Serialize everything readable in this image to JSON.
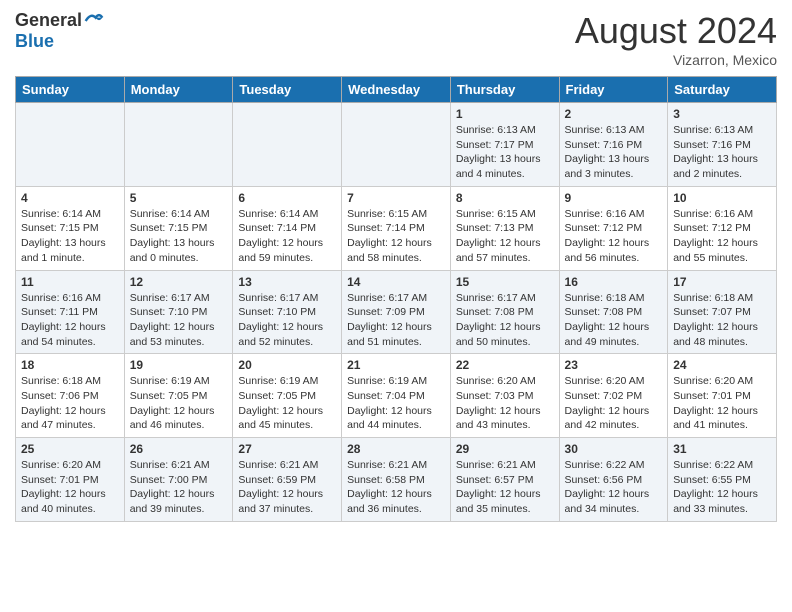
{
  "header": {
    "logo_general": "General",
    "logo_blue": "Blue",
    "month_year": "August 2024",
    "location": "Vizarron, Mexico"
  },
  "days_of_week": [
    "Sunday",
    "Monday",
    "Tuesday",
    "Wednesday",
    "Thursday",
    "Friday",
    "Saturday"
  ],
  "weeks": [
    [
      {
        "day": "",
        "sunrise": "",
        "sunset": "",
        "daylight": "",
        "empty": true
      },
      {
        "day": "",
        "sunrise": "",
        "sunset": "",
        "daylight": "",
        "empty": true
      },
      {
        "day": "",
        "sunrise": "",
        "sunset": "",
        "daylight": "",
        "empty": true
      },
      {
        "day": "",
        "sunrise": "",
        "sunset": "",
        "daylight": "",
        "empty": true
      },
      {
        "day": "1",
        "sunrise": "Sunrise: 6:13 AM",
        "sunset": "Sunset: 7:17 PM",
        "daylight": "Daylight: 13 hours and 4 minutes."
      },
      {
        "day": "2",
        "sunrise": "Sunrise: 6:13 AM",
        "sunset": "Sunset: 7:16 PM",
        "daylight": "Daylight: 13 hours and 3 minutes."
      },
      {
        "day": "3",
        "sunrise": "Sunrise: 6:13 AM",
        "sunset": "Sunset: 7:16 PM",
        "daylight": "Daylight: 13 hours and 2 minutes."
      }
    ],
    [
      {
        "day": "4",
        "sunrise": "Sunrise: 6:14 AM",
        "sunset": "Sunset: 7:15 PM",
        "daylight": "Daylight: 13 hours and 1 minute."
      },
      {
        "day": "5",
        "sunrise": "Sunrise: 6:14 AM",
        "sunset": "Sunset: 7:15 PM",
        "daylight": "Daylight: 13 hours and 0 minutes."
      },
      {
        "day": "6",
        "sunrise": "Sunrise: 6:14 AM",
        "sunset": "Sunset: 7:14 PM",
        "daylight": "Daylight: 12 hours and 59 minutes."
      },
      {
        "day": "7",
        "sunrise": "Sunrise: 6:15 AM",
        "sunset": "Sunset: 7:14 PM",
        "daylight": "Daylight: 12 hours and 58 minutes."
      },
      {
        "day": "8",
        "sunrise": "Sunrise: 6:15 AM",
        "sunset": "Sunset: 7:13 PM",
        "daylight": "Daylight: 12 hours and 57 minutes."
      },
      {
        "day": "9",
        "sunrise": "Sunrise: 6:16 AM",
        "sunset": "Sunset: 7:12 PM",
        "daylight": "Daylight: 12 hours and 56 minutes."
      },
      {
        "day": "10",
        "sunrise": "Sunrise: 6:16 AM",
        "sunset": "Sunset: 7:12 PM",
        "daylight": "Daylight: 12 hours and 55 minutes."
      }
    ],
    [
      {
        "day": "11",
        "sunrise": "Sunrise: 6:16 AM",
        "sunset": "Sunset: 7:11 PM",
        "daylight": "Daylight: 12 hours and 54 minutes."
      },
      {
        "day": "12",
        "sunrise": "Sunrise: 6:17 AM",
        "sunset": "Sunset: 7:10 PM",
        "daylight": "Daylight: 12 hours and 53 minutes."
      },
      {
        "day": "13",
        "sunrise": "Sunrise: 6:17 AM",
        "sunset": "Sunset: 7:10 PM",
        "daylight": "Daylight: 12 hours and 52 minutes."
      },
      {
        "day": "14",
        "sunrise": "Sunrise: 6:17 AM",
        "sunset": "Sunset: 7:09 PM",
        "daylight": "Daylight: 12 hours and 51 minutes."
      },
      {
        "day": "15",
        "sunrise": "Sunrise: 6:17 AM",
        "sunset": "Sunset: 7:08 PM",
        "daylight": "Daylight: 12 hours and 50 minutes."
      },
      {
        "day": "16",
        "sunrise": "Sunrise: 6:18 AM",
        "sunset": "Sunset: 7:08 PM",
        "daylight": "Daylight: 12 hours and 49 minutes."
      },
      {
        "day": "17",
        "sunrise": "Sunrise: 6:18 AM",
        "sunset": "Sunset: 7:07 PM",
        "daylight": "Daylight: 12 hours and 48 minutes."
      }
    ],
    [
      {
        "day": "18",
        "sunrise": "Sunrise: 6:18 AM",
        "sunset": "Sunset: 7:06 PM",
        "daylight": "Daylight: 12 hours and 47 minutes."
      },
      {
        "day": "19",
        "sunrise": "Sunrise: 6:19 AM",
        "sunset": "Sunset: 7:05 PM",
        "daylight": "Daylight: 12 hours and 46 minutes."
      },
      {
        "day": "20",
        "sunrise": "Sunrise: 6:19 AM",
        "sunset": "Sunset: 7:05 PM",
        "daylight": "Daylight: 12 hours and 45 minutes."
      },
      {
        "day": "21",
        "sunrise": "Sunrise: 6:19 AM",
        "sunset": "Sunset: 7:04 PM",
        "daylight": "Daylight: 12 hours and 44 minutes."
      },
      {
        "day": "22",
        "sunrise": "Sunrise: 6:20 AM",
        "sunset": "Sunset: 7:03 PM",
        "daylight": "Daylight: 12 hours and 43 minutes."
      },
      {
        "day": "23",
        "sunrise": "Sunrise: 6:20 AM",
        "sunset": "Sunset: 7:02 PM",
        "daylight": "Daylight: 12 hours and 42 minutes."
      },
      {
        "day": "24",
        "sunrise": "Sunrise: 6:20 AM",
        "sunset": "Sunset: 7:01 PM",
        "daylight": "Daylight: 12 hours and 41 minutes."
      }
    ],
    [
      {
        "day": "25",
        "sunrise": "Sunrise: 6:20 AM",
        "sunset": "Sunset: 7:01 PM",
        "daylight": "Daylight: 12 hours and 40 minutes."
      },
      {
        "day": "26",
        "sunrise": "Sunrise: 6:21 AM",
        "sunset": "Sunset: 7:00 PM",
        "daylight": "Daylight: 12 hours and 39 minutes."
      },
      {
        "day": "27",
        "sunrise": "Sunrise: 6:21 AM",
        "sunset": "Sunset: 6:59 PM",
        "daylight": "Daylight: 12 hours and 37 minutes."
      },
      {
        "day": "28",
        "sunrise": "Sunrise: 6:21 AM",
        "sunset": "Sunset: 6:58 PM",
        "daylight": "Daylight: 12 hours and 36 minutes."
      },
      {
        "day": "29",
        "sunrise": "Sunrise: 6:21 AM",
        "sunset": "Sunset: 6:57 PM",
        "daylight": "Daylight: 12 hours and 35 minutes."
      },
      {
        "day": "30",
        "sunrise": "Sunrise: 6:22 AM",
        "sunset": "Sunset: 6:56 PM",
        "daylight": "Daylight: 12 hours and 34 minutes."
      },
      {
        "day": "31",
        "sunrise": "Sunrise: 6:22 AM",
        "sunset": "Sunset: 6:55 PM",
        "daylight": "Daylight: 12 hours and 33 minutes."
      }
    ]
  ]
}
